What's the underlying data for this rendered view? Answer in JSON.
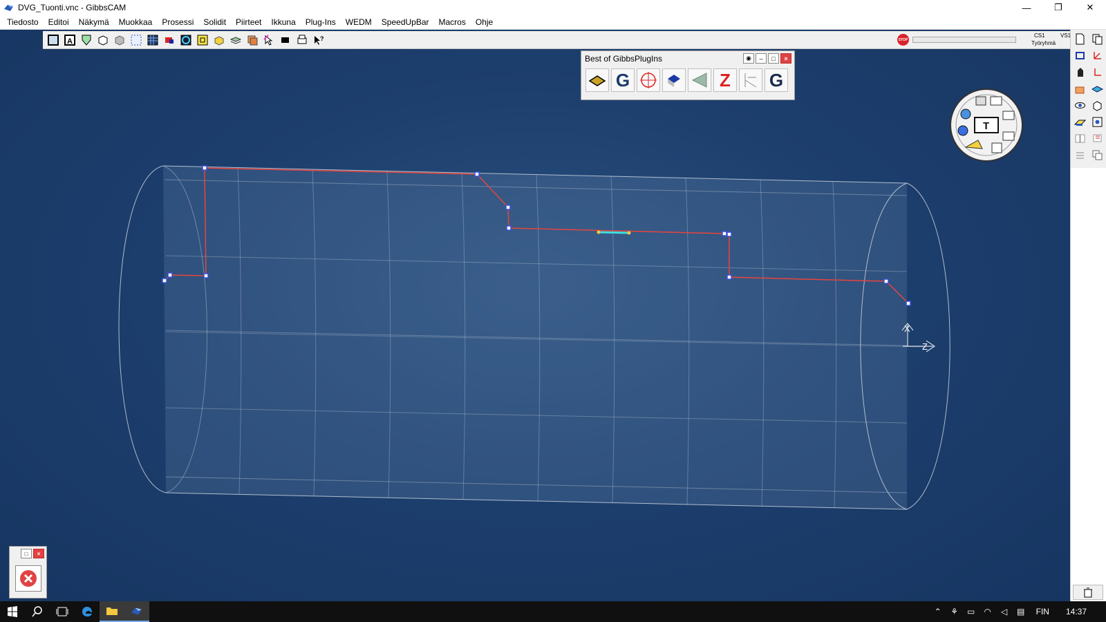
{
  "window": {
    "title": "DVG_Tuonti.vnc - GibbsCAM",
    "minimize": "—",
    "restore": "❐",
    "close": "✕"
  },
  "menu": {
    "items": [
      "Tiedosto",
      "Editoi",
      "Näkymä",
      "Muokkaa",
      "Prosessi",
      "Solidit",
      "Piirteet",
      "Ikkuna",
      "Plug-Ins",
      "WEDM",
      "SpeedUpBar",
      "Macros",
      "Ohje"
    ]
  },
  "toolbar": {
    "stop_label": "STOP",
    "cs": "CS1",
    "vs": "VS1",
    "workgroup": "Työryhmä",
    "progress": 0
  },
  "palette": {
    "title": "Best of GibbsPlugIns",
    "btn_g1": "G",
    "btn_z": "Z",
    "btn_g2": "G"
  },
  "viewport": {
    "axis_x": "X",
    "axis_z": "Z"
  },
  "colors": {
    "viewport_bg": "#1d3f6e",
    "profile": "#e8453c",
    "node": "#3a4fd8",
    "wire": "#c9d2de"
  },
  "taskbar": {
    "lang": "FIN",
    "clock": "14:37"
  }
}
